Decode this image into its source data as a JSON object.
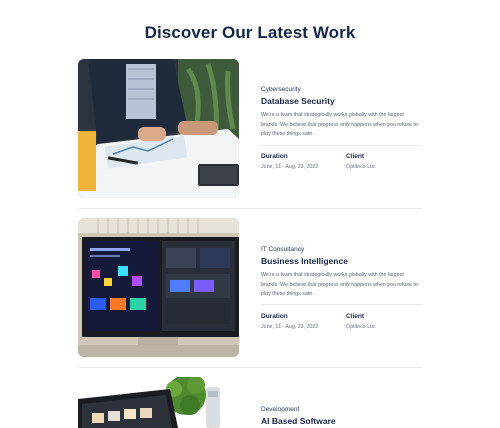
{
  "page": {
    "title": "Discover Our Latest Work"
  },
  "works": [
    {
      "category": "Cybersecurity",
      "title": "Database Security",
      "description": "We're a team that strategically works globally with the largest brands. We believe that progress only happens when you refuse to play these things safe.",
      "duration_label": "Duration",
      "duration": "June, 11 - Aug, 23, 2022",
      "client_label": "Client",
      "client": "Optiteco Ltd."
    },
    {
      "category": "IT Consultancy",
      "title": "Business Intelligence",
      "description": "We're a team that strategically works globally with the largest brands. We believe that progress only happens when you refuse to play these things safe.",
      "duration_label": "Duration",
      "duration": "June, 11 - Aug, 23, 2022",
      "client_label": "Client",
      "client": "Optiteco Ltd."
    },
    {
      "category": "Development",
      "title": "AI Based Software"
    }
  ]
}
